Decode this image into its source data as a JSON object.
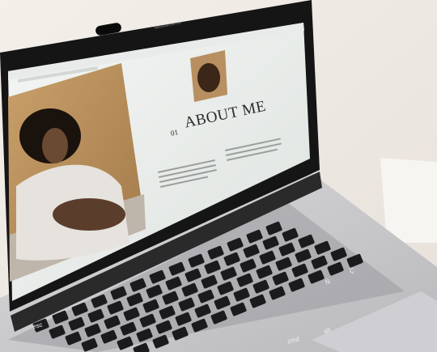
{
  "browser": {
    "url_text": "hellorebecca.com"
  },
  "website": {
    "section_number": "01",
    "heading": "ABOUT ME"
  },
  "keyboard": {
    "visible_key_labels": [
      "Ç",
      "Ñ",
      "cmd",
      "alt",
      "esc"
    ]
  }
}
